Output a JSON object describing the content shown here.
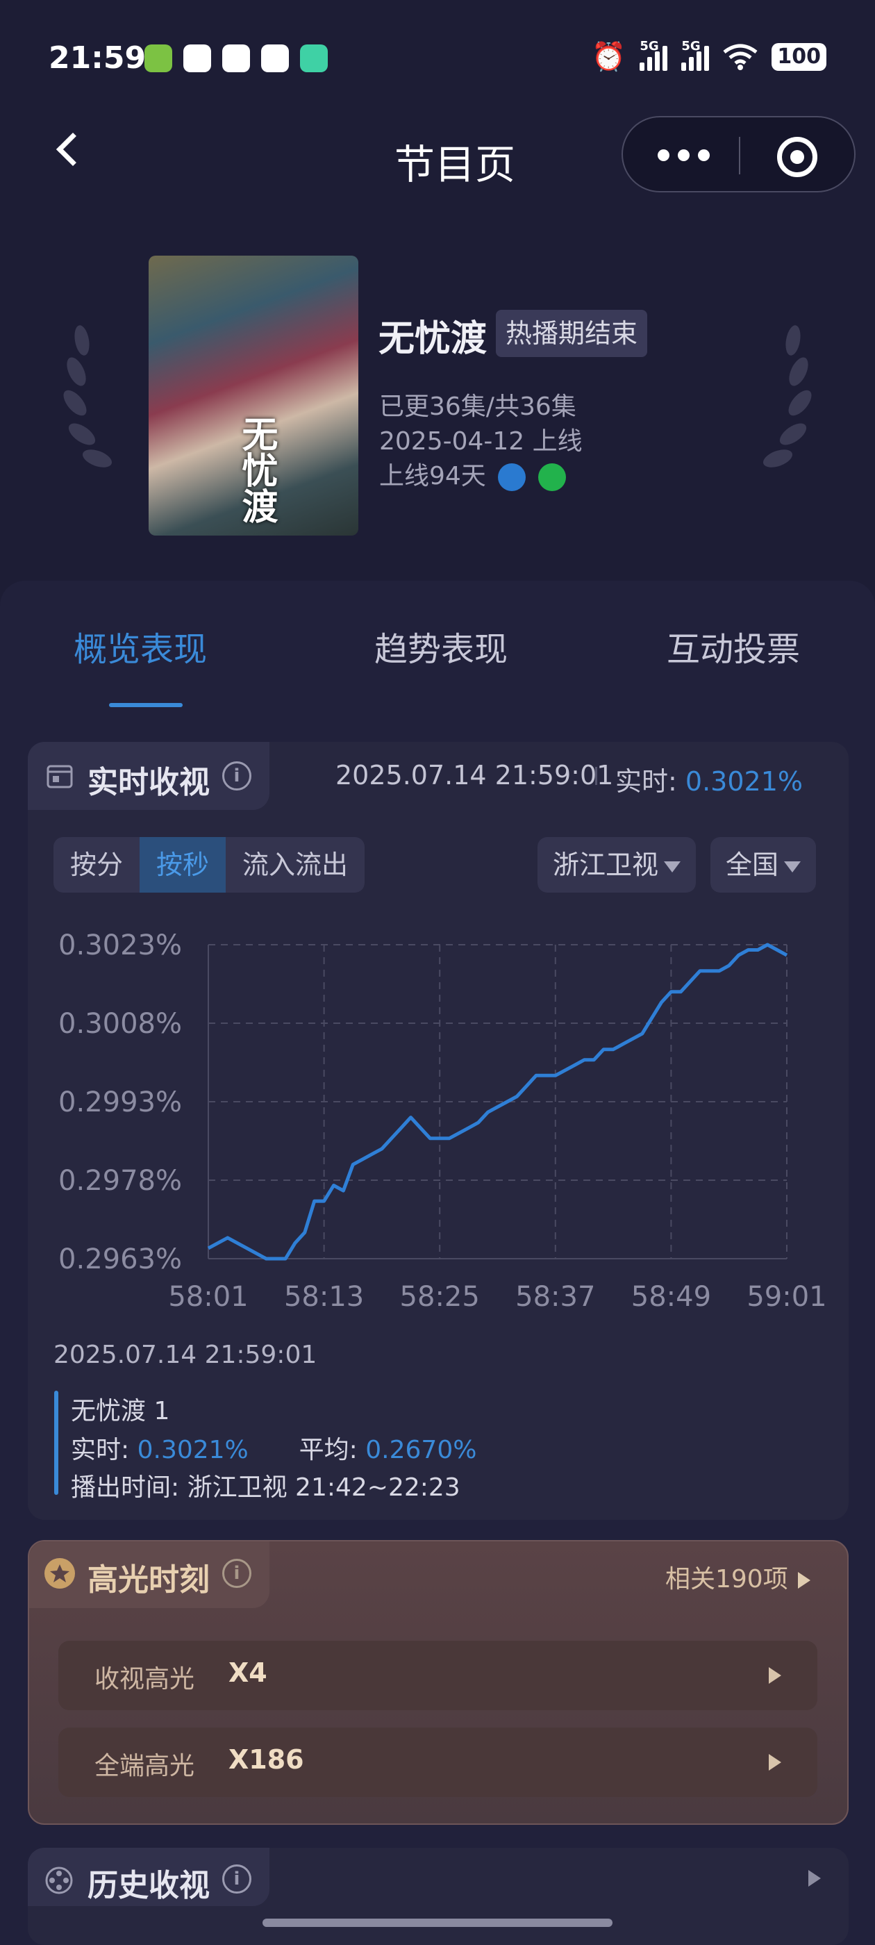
{
  "status": {
    "time": "21:59",
    "battery": "100",
    "net1": "5G",
    "net2": "5G"
  },
  "header": {
    "title": "节目页"
  },
  "show": {
    "name": "无忧渡",
    "badge": "热播期结束",
    "episodes": "已更36集/共36集",
    "premiere": "2025-04-12 上线",
    "days_online": "上线94天",
    "poster_title": "无忧渡"
  },
  "tabs": [
    {
      "label": "概览表现"
    },
    {
      "label": "趋势表现"
    },
    {
      "label": "互动投票"
    }
  ],
  "realtime": {
    "title": "实时收视",
    "info": "i",
    "timestamp": "2025.07.14 21:59:01",
    "realtime_label": "实时:",
    "realtime_value": "0.3021%",
    "modes": [
      "按分",
      "按秒",
      "流入流出"
    ],
    "active_mode": "按秒",
    "channel": "浙江卫视",
    "region": "全国"
  },
  "chart_data": {
    "type": "line",
    "title": "",
    "xlabel": "",
    "ylabel": "",
    "x_ticks": [
      "58:01",
      "58:13",
      "58:25",
      "58:37",
      "58:49",
      "59:01"
    ],
    "y_ticks": [
      "0.3023%",
      "0.3008%",
      "0.2993%",
      "0.2978%",
      "0.2963%"
    ],
    "ylim": [
      0.2963,
      0.3023
    ],
    "xlim": [
      0,
      60
    ],
    "grid": true,
    "series": [
      {
        "color": "#2f7fd6",
        "x": [
          0,
          2,
          4,
          6,
          7,
          8,
          9,
          10,
          11,
          12,
          13,
          14,
          15,
          16,
          17,
          18,
          19,
          20,
          21,
          22,
          23,
          24,
          25,
          26,
          27,
          28,
          29,
          30,
          31,
          32,
          33,
          34,
          35,
          36,
          37,
          38,
          39,
          40,
          41,
          42,
          43,
          44,
          45,
          46,
          47,
          48,
          49,
          50,
          51,
          52,
          53,
          54,
          55,
          56,
          57,
          58,
          59,
          60
        ],
        "y": [
          0.2965,
          0.2967,
          0.2965,
          0.2963,
          0.2963,
          0.2963,
          0.2966,
          0.2968,
          0.2974,
          0.2974,
          0.2977,
          0.2976,
          0.2981,
          0.2982,
          0.2983,
          0.2984,
          0.2986,
          0.2988,
          0.299,
          0.2988,
          0.2986,
          0.2986,
          0.2986,
          0.2987,
          0.2988,
          0.2989,
          0.2991,
          0.2992,
          0.2993,
          0.2994,
          0.2996,
          0.2998,
          0.2998,
          0.2998,
          0.2999,
          0.3,
          0.3001,
          0.3001,
          0.3003,
          0.3003,
          0.3004,
          0.3005,
          0.3006,
          0.3009,
          0.3012,
          0.3014,
          0.3014,
          0.3016,
          0.3018,
          0.3018,
          0.3018,
          0.3019,
          0.3021,
          0.3022,
          0.3022,
          0.3023,
          0.3022,
          0.3021
        ]
      }
    ]
  },
  "legend": {
    "timestamp": "2025.07.14 21:59:01",
    "name": "无忧渡 1",
    "realtime_label": "实时:",
    "realtime_value": "0.3021%",
    "avg_label": "平均:",
    "avg_value": "0.2670%",
    "broadcast_label": "播出时间:",
    "broadcast_value": "浙江卫视 21:42~22:23"
  },
  "highlights": {
    "title": "高光时刻",
    "related": "相关190项",
    "rows": [
      {
        "label": "收视高光",
        "value": "X4"
      },
      {
        "label": "全端高光",
        "value": "X186"
      }
    ]
  },
  "history": {
    "title": "历史收视"
  },
  "colors": {
    "accent": "#3a8ad8",
    "background": "#1d1d35",
    "highlight_gold": "#c9a067"
  }
}
